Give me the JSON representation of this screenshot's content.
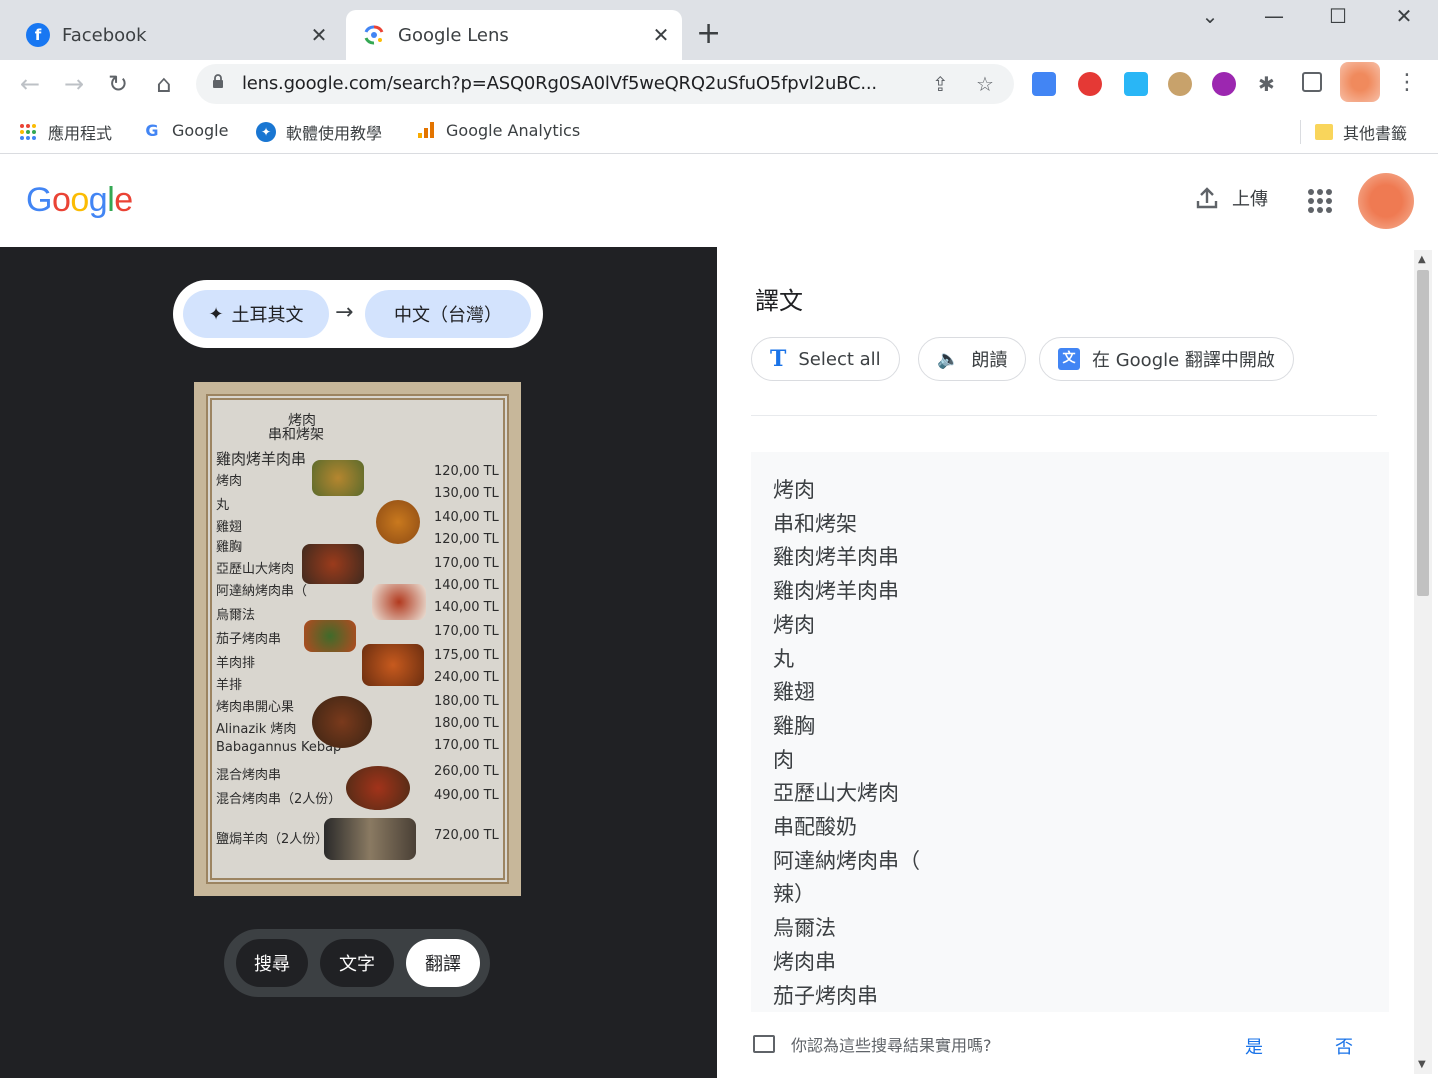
{
  "browser": {
    "tabs": [
      {
        "title": "Facebook",
        "icon": "facebook-icon"
      },
      {
        "title": "Google Lens",
        "icon": "google-lens-icon"
      }
    ],
    "url": "lens.google.com/search?p=ASQ0Rg0SA0lVf5weQRQ2uSfuO5fpvl2uBC...",
    "bookmarks": [
      "應用程式",
      "Google",
      "軟體使用教學",
      "Google Analytics"
    ],
    "other_bookmarks": "其他書籤"
  },
  "header": {
    "logo": "Google",
    "upload_label": "上傳"
  },
  "lens": {
    "source_lang": "土耳其文",
    "target_lang": "中文（台灣）",
    "modes": {
      "search": "搜尋",
      "text": "文字",
      "translate": "翻譯"
    },
    "menu_image": {
      "lines": [
        "烤肉",
        "串和烤架",
        "雞肉烤羊肉串",
        "烤肉",
        "丸",
        "雞翅",
        "雞胸",
        "亞歷山大烤肉",
        "阿達納烤肉串（",
        "烏爾法",
        "茄子烤肉串",
        "羊肉排",
        "羊排",
        "烤肉串開心果",
        "Alinazik 烤肉",
        "Babagannus Kebap",
        "混合烤肉串",
        "混合烤肉串（2人份）",
        "鹽焗羊肉（2人份）"
      ],
      "prices": [
        "120,00 TL",
        "130,00 TL",
        "140,00 TL",
        "120,00 TL",
        "170,00 TL",
        "140,00 TL",
        "140,00 TL",
        "170,00 TL",
        "175,00 TL",
        "240,00 TL",
        "180,00 TL",
        "180,00 TL",
        "170,00 TL",
        "260,00 TL",
        "490,00 TL",
        "720,00 TL"
      ]
    }
  },
  "results": {
    "title": "譯文",
    "actions": {
      "select_all": "Select all",
      "read_aloud": "朗讀",
      "open_translate": "在 Google 翻譯中開啟"
    },
    "translated_lines": [
      "烤肉",
      "串和烤架",
      "雞肉烤羊肉串",
      "雞肉烤羊肉串",
      "烤肉",
      "丸",
      "雞翅",
      "雞胸",
      "肉",
      "亞歷山大烤肉",
      "串配酸奶",
      "阿達納烤肉串（",
      "辣）",
      "烏爾法",
      "烤肉串",
      "茄子烤肉串"
    ],
    "feedback_question": "你認為這些搜尋結果實用嗎?",
    "feedback_yes": "是",
    "feedback_no": "否"
  },
  "colors": {
    "accent": "#1a73e8",
    "chip_bg": "#d3e3fd",
    "dark_bg": "#202124"
  }
}
